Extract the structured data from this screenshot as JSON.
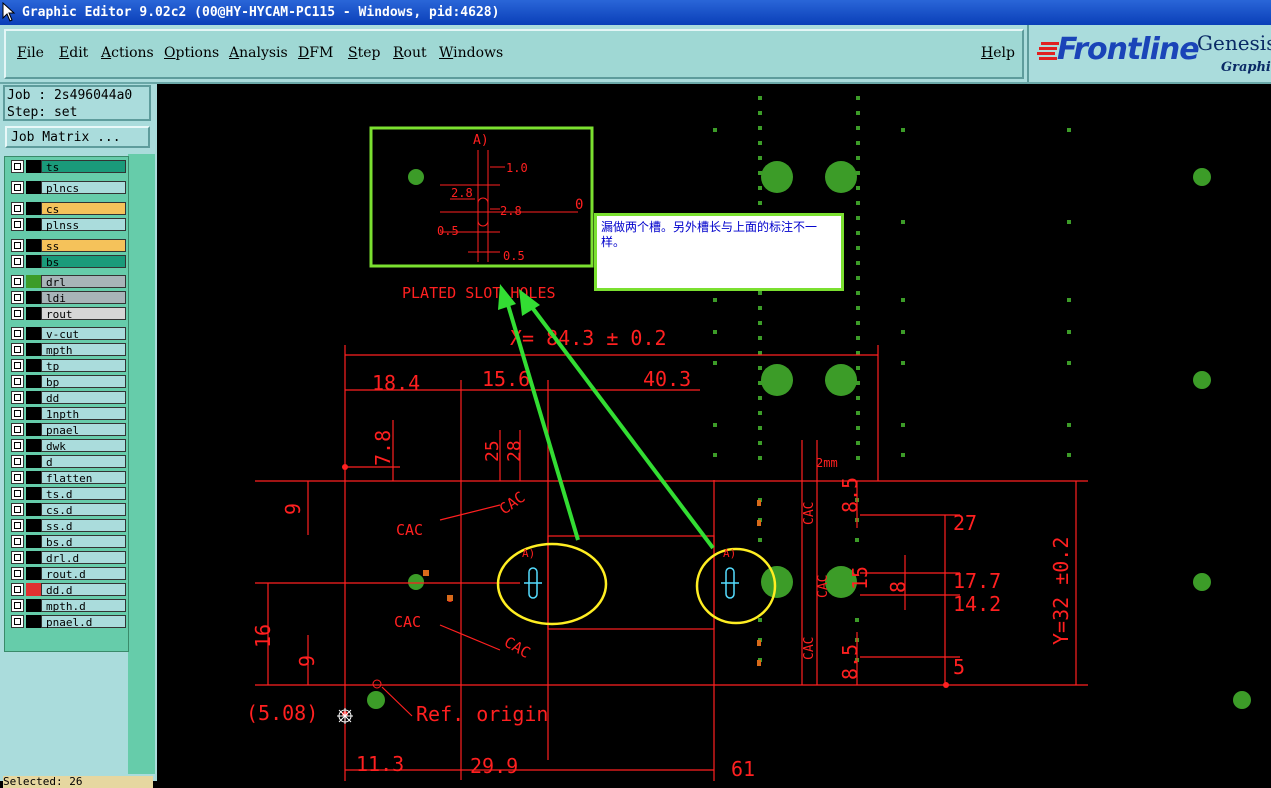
{
  "window": {
    "title": "Graphic Editor 9.02c2 (00@HY-HYCAM-PC115 - Windows, pid:4628)"
  },
  "menu": {
    "items": [
      "File",
      "Edit",
      "Actions",
      "Options",
      "Analysis",
      "DFM",
      "Step",
      "Rout",
      "Windows"
    ],
    "help": "Help"
  },
  "logo": {
    "brand": "Frontline",
    "product": "Genesis",
    "sub": "Graphic"
  },
  "job": {
    "job_label": "Job : 2s496044a0",
    "step_label": "Step: set",
    "matrix_button": "Job Matrix ..."
  },
  "layers": [
    {
      "name": "ts",
      "color": "#1a9a7a",
      "swatch": "#000"
    },
    {
      "name": "plncs",
      "color": "#aadcdc",
      "swatch": "#000"
    },
    {
      "name": "cs",
      "color": "#f5c25a",
      "swatch": "#000"
    },
    {
      "name": "plnss",
      "color": "#aadcdc",
      "swatch": "#000"
    },
    {
      "name": "ss",
      "color": "#f5c25a",
      "swatch": "#000"
    },
    {
      "name": "bs",
      "color": "#1a9a7a",
      "swatch": "#000"
    },
    {
      "name": "drl",
      "color": "#a8b4b8",
      "swatch": "#3c9c28"
    },
    {
      "name": "ldi",
      "color": "#a8b4b8",
      "swatch": "#000"
    },
    {
      "name": "rout",
      "color": "#d6d6d6",
      "swatch": "#000"
    },
    {
      "name": "v-cut",
      "color": "#aadcdc",
      "swatch": "#000"
    },
    {
      "name": "mpth",
      "color": "#aadcdc",
      "swatch": "#000"
    },
    {
      "name": "tp",
      "color": "#aadcdc",
      "swatch": "#000"
    },
    {
      "name": "bp",
      "color": "#aadcdc",
      "swatch": "#000"
    },
    {
      "name": "dd",
      "color": "#aadcdc",
      "swatch": "#000"
    },
    {
      "name": "1npth",
      "color": "#aadcdc",
      "swatch": "#000"
    },
    {
      "name": "pnael",
      "color": "#aadcdc",
      "swatch": "#000"
    },
    {
      "name": "dwk",
      "color": "#aadcdc",
      "swatch": "#000"
    },
    {
      "name": "d",
      "color": "#aadcdc",
      "swatch": "#000"
    },
    {
      "name": "flatten",
      "color": "#aadcdc",
      "swatch": "#000"
    },
    {
      "name": "ts.d",
      "color": "#aadcdc",
      "swatch": "#000"
    },
    {
      "name": "cs.d",
      "color": "#aadcdc",
      "swatch": "#000"
    },
    {
      "name": "ss.d",
      "color": "#aadcdc",
      "swatch": "#000"
    },
    {
      "name": "bs.d",
      "color": "#aadcdc",
      "swatch": "#000"
    },
    {
      "name": "drl.d",
      "color": "#aadcdc",
      "swatch": "#000"
    },
    {
      "name": "rout.d",
      "color": "#aadcdc",
      "swatch": "#000"
    },
    {
      "name": "dd.d",
      "color": "#aadcdc",
      "swatch": "#e03030"
    },
    {
      "name": "mpth.d",
      "color": "#aadcdc",
      "swatch": "#000"
    },
    {
      "name": "pnael.d",
      "color": "#aadcdc",
      "swatch": "#000"
    }
  ],
  "status": {
    "text": "Selected: 26"
  },
  "annotation": {
    "text": "漏做两个槽。另外槽长与上面的标注不一样。"
  },
  "drawing": {
    "detail_title": "A)",
    "detail_dims": [
      "1.0",
      "2.8",
      "2.8",
      "0",
      "0.5",
      "0.5"
    ],
    "slot_label": "PLATED SLOT HOLES",
    "x_dim": "X= 84.3 ± 0.2",
    "y_dim": "Y=32 ±0.2",
    "top_dims": [
      "18.4",
      "15.6",
      "40.3"
    ],
    "vert_dims": [
      "7.8",
      "25",
      "28"
    ],
    "mm_label": "2mm",
    "left_dims": [
      "9",
      "16",
      "9"
    ],
    "right_dims": [
      "27",
      "17.7",
      "14.2",
      "5",
      "8",
      "8.5",
      "8.5",
      "15"
    ],
    "bottom_dims": [
      "11.3",
      "29.9",
      "61"
    ],
    "ref_left": "(5.08)",
    "ref_origin": "Ref. origin",
    "cac": "CAC",
    "slot_tag": "A)"
  },
  "colors": {
    "dim": "#ff2020",
    "pad": "#3c9c28",
    "arrow": "#33dd33",
    "ellipse": "#ffee22",
    "slot": "#55ddff"
  }
}
